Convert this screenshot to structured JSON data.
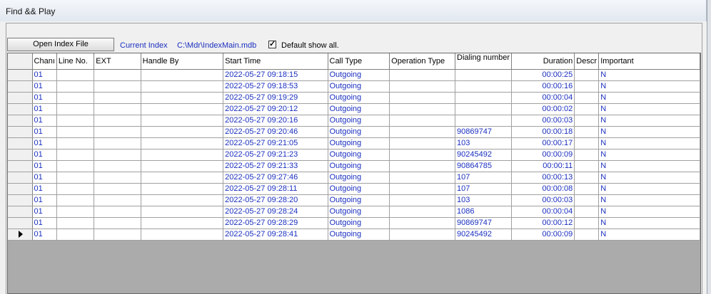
{
  "window": {
    "title": "Find && Play"
  },
  "toolbar": {
    "open_index_label": "Open Index File",
    "current_index_label": "Current Index",
    "current_index_path": "C:\\Mdr\\IndexMain.mdb",
    "default_show_all_label": "Default show all.",
    "default_show_all_checked": true,
    "check_glyph": "✓"
  },
  "table": {
    "headers": {
      "channel": "Chanı",
      "line_no": "Line No.",
      "ext": "EXT",
      "handle_by": "Handle By",
      "start_time": "Start Time",
      "call_type": "Call Type",
      "operation_type": "Operation Type",
      "dialing_number": "Dialing number",
      "duration": "Duration",
      "descr": "Descr",
      "important": "Important"
    },
    "selected_row_index": 15,
    "rows": [
      {
        "channel": "01",
        "line_no": "",
        "ext": "",
        "handle_by": "",
        "start_time": "2022-05-27 09:18:15",
        "call_type": "Outgoing",
        "operation_type": "",
        "dialing_number": "",
        "duration": "00:00:25",
        "descr": "",
        "important": "N"
      },
      {
        "channel": "01",
        "line_no": "",
        "ext": "",
        "handle_by": "",
        "start_time": "2022-05-27 09:18:53",
        "call_type": "Outgoing",
        "operation_type": "",
        "dialing_number": "",
        "duration": "00:00:16",
        "descr": "",
        "important": "N"
      },
      {
        "channel": "01",
        "line_no": "",
        "ext": "",
        "handle_by": "",
        "start_time": "2022-05-27 09:19:29",
        "call_type": "Outgoing",
        "operation_type": "",
        "dialing_number": "",
        "duration": "00:00:04",
        "descr": "",
        "important": "N"
      },
      {
        "channel": "01",
        "line_no": "",
        "ext": "",
        "handle_by": "",
        "start_time": "2022-05-27 09:20:12",
        "call_type": "Outgoing",
        "operation_type": "",
        "dialing_number": "",
        "duration": "00:00:02",
        "descr": "",
        "important": "N"
      },
      {
        "channel": "01",
        "line_no": "",
        "ext": "",
        "handle_by": "",
        "start_time": "2022-05-27 09:20:16",
        "call_type": "Outgoing",
        "operation_type": "",
        "dialing_number": "",
        "duration": "00:00:03",
        "descr": "",
        "important": "N"
      },
      {
        "channel": "01",
        "line_no": "",
        "ext": "",
        "handle_by": "",
        "start_time": "2022-05-27 09:20:46",
        "call_type": "Outgoing",
        "operation_type": "",
        "dialing_number": "90869747",
        "duration": "00:00:18",
        "descr": "",
        "important": "N"
      },
      {
        "channel": "01",
        "line_no": "",
        "ext": "",
        "handle_by": "",
        "start_time": "2022-05-27 09:21:05",
        "call_type": "Outgoing",
        "operation_type": "",
        "dialing_number": "103",
        "duration": "00:00:17",
        "descr": "",
        "important": "N"
      },
      {
        "channel": "01",
        "line_no": "",
        "ext": "",
        "handle_by": "",
        "start_time": "2022-05-27 09:21:23",
        "call_type": "Outgoing",
        "operation_type": "",
        "dialing_number": "90245492",
        "duration": "00:00:09",
        "descr": "",
        "important": "N"
      },
      {
        "channel": "01",
        "line_no": "",
        "ext": "",
        "handle_by": "",
        "start_time": "2022-05-27 09:21:33",
        "call_type": "Outgoing",
        "operation_type": "",
        "dialing_number": "90864785",
        "duration": "00:00:11",
        "descr": "",
        "important": "N"
      },
      {
        "channel": "01",
        "line_no": "",
        "ext": "",
        "handle_by": "",
        "start_time": "2022-05-27 09:27:46",
        "call_type": "Outgoing",
        "operation_type": "",
        "dialing_number": "107",
        "duration": "00:00:13",
        "descr": "",
        "important": "N"
      },
      {
        "channel": "01",
        "line_no": "",
        "ext": "",
        "handle_by": "",
        "start_time": "2022-05-27 09:28:11",
        "call_type": "Outgoing",
        "operation_type": "",
        "dialing_number": "107",
        "duration": "00:00:08",
        "descr": "",
        "important": "N"
      },
      {
        "channel": "01",
        "line_no": "",
        "ext": "",
        "handle_by": "",
        "start_time": "2022-05-27 09:28:20",
        "call_type": "Outgoing",
        "operation_type": "",
        "dialing_number": "103",
        "duration": "00:00:03",
        "descr": "",
        "important": "N"
      },
      {
        "channel": "01",
        "line_no": "",
        "ext": "",
        "handle_by": "",
        "start_time": "2022-05-27 09:28:24",
        "call_type": "Outgoing",
        "operation_type": "",
        "dialing_number": "1086",
        "duration": "00:00:04",
        "descr": "",
        "important": "N"
      },
      {
        "channel": "01",
        "line_no": "",
        "ext": "",
        "handle_by": "",
        "start_time": "2022-05-27 09:28:29",
        "call_type": "Outgoing",
        "operation_type": "",
        "dialing_number": "90869747",
        "duration": "00:00:12",
        "descr": "",
        "important": "N"
      },
      {
        "channel": "01",
        "line_no": "",
        "ext": "",
        "handle_by": "",
        "start_time": "2022-05-27 09:28:41",
        "call_type": "Outgoing",
        "operation_type": "",
        "dialing_number": "90245492",
        "duration": "00:00:09",
        "descr": "",
        "important": "N"
      }
    ]
  },
  "colors": {
    "data_text": "#1a2fbf",
    "grid_background": "#ababab"
  }
}
